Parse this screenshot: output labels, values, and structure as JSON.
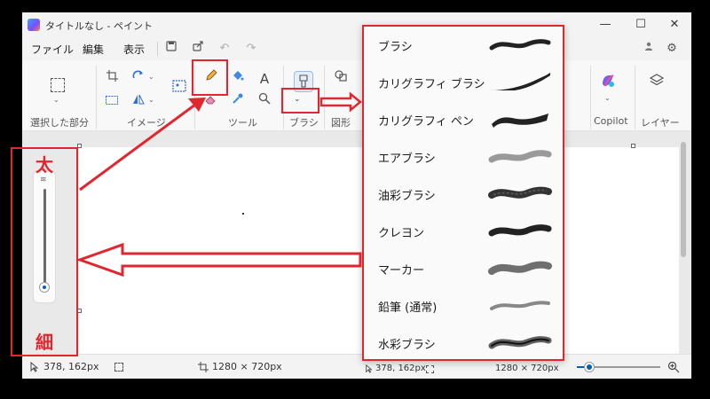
{
  "window": {
    "title": "タイトルなし - ペイント",
    "controls": {
      "minimize": "—",
      "maximize": "☐",
      "close": "✕"
    }
  },
  "menu": {
    "file": "ファイル",
    "edit": "編集",
    "view": "表示"
  },
  "ribbon": {
    "groups": {
      "selection": "選択した部分",
      "image": "イメージ",
      "tools": "ツール",
      "brushes": "ブラシ",
      "shapes": "図形",
      "copilot": "Copilot",
      "layers": "レイヤー"
    },
    "text_tool_glyph": "A"
  },
  "brush_menu": {
    "items": [
      {
        "label": "ブラシ"
      },
      {
        "label": "カリグラフィ ブラシ"
      },
      {
        "label": "カリグラフィ ペン"
      },
      {
        "label": "エアブラシ"
      },
      {
        "label": "油彩ブラシ"
      },
      {
        "label": "クレヨン"
      },
      {
        "label": "マーカー"
      },
      {
        "label": "鉛筆 (通常)"
      },
      {
        "label": "水彩ブラシ"
      }
    ]
  },
  "status": {
    "cursor_pos": "378, 162px",
    "canvas_size": "1280 × 720px",
    "cursor_pos_2": "378, 162px",
    "canvas_size_2": "1280 × 720px"
  },
  "annotations": {
    "thick": "太",
    "thin": "細"
  },
  "colors": {
    "annotation_red": "#e0262e",
    "accent": "#005fb8"
  }
}
